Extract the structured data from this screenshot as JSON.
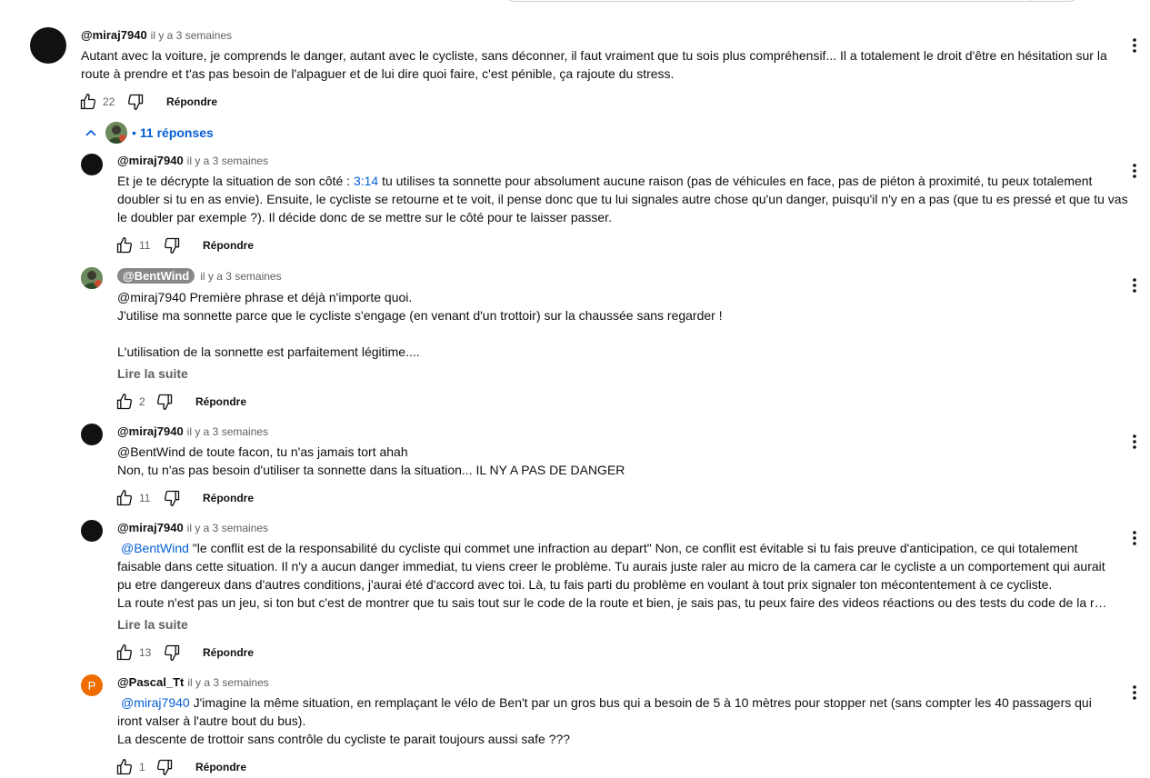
{
  "comments": [
    {
      "author": "@miraj7940",
      "time": "il y a 3 semaines",
      "lines": [
        "Autant avec la voiture, je comprends le danger, autant avec le cycliste, sans déconner, il faut vraiment que tu sois plus compréhensif... Il a totalement le droit d'être en hésitation sur la",
        "route à prendre et t'as pas besoin de l'alpaguer et de lui dire quoi faire, c'est pénible, ça rajoute du stress."
      ],
      "likes": "22",
      "reply_label": "Répondre"
    }
  ],
  "replies_toggle": {
    "label": "11 réponses",
    "dot": "•"
  },
  "replies": [
    {
      "author": "@miraj7940",
      "time": "il y a 3 semaines",
      "line1_prefix": "Et je te décrypte la situation de son côté : ",
      "timestamp_link": "3:14",
      "line1_suffix": " tu utilises ta sonnette pour absolument aucune raison (pas de véhicules en face, pas de piéton à proximité, tu peux totalement",
      "line2": "doubler si tu en as envie). Ensuite, le cycliste se retourne et te voit, il pense donc que tu lui signales autre chose qu'un danger, puisqu'il n'y en a pas (que tu es pressé et que tu vas",
      "line3": "le doubler par exemple ?). Il décide donc de se mettre sur le côté pour te laisser passer.",
      "likes": "11",
      "reply_label": "Répondre"
    },
    {
      "author": "@BentWind",
      "time": "il y a 3 semaines",
      "line1": "@miraj7940 Première phrase et déjà n'importe quoi.",
      "line2": "J'utilise ma sonnette parce que le cycliste s'engage (en venant d'un trottoir) sur la chaussée sans regarder !",
      "line4": "L'utilisation de la sonnette est parfaitement légitime....",
      "read_more": "Lire la suite",
      "likes": "2",
      "reply_label": "Répondre"
    },
    {
      "author": "@miraj7940",
      "time": "il y a 3 semaines",
      "line1": "@BentWind  de toute facon, tu n'as jamais tort ahah",
      "line2": "Non, tu n'as pas besoin d'utiliser ta sonnette dans la situation... IL NY A PAS DE DANGER",
      "likes": "11",
      "reply_label": "Répondre"
    },
    {
      "author": "@miraj7940",
      "time": "il y a 3 semaines",
      "mention": "@BentWind",
      "line1_rest": "  \"le conflit est de la responsabilité du cycliste qui commet une infraction au depart\" Non, ce conflit est évitable si tu fais preuve d'anticipation, ce qui totalement",
      "line2": "faisable dans cette situation. Il n'y a aucun danger immediat, tu viens creer le problème. Tu aurais juste raler au micro de la camera car le cycliste a un comportement qui aurait",
      "line3": "pu etre dangereux dans d'autres conditions, j'aurai été d'accord avec toi. Là, tu fais parti du problème en voulant à tout prix signaler ton mécontentement à ce cycliste.",
      "line4": "La route n'est pas un jeu, si ton but c'est de montrer que tu sais tout sur le code de la route et bien, je sais pas, tu peux faire des videos réactions ou des tests du code de la route",
      "read_more": "Lire la suite",
      "likes": "13",
      "reply_label": "Répondre"
    },
    {
      "author": "@Pascal_Tt",
      "time": "il y a 3 semaines",
      "avatar_letter": "P",
      "mention": "@miraj7940",
      "line1_rest": "  J'imagine la même situation, en remplaçant le vélo de Ben't par un gros bus qui a besoin de 5 à 10 mètres pour stopper net (sans compter les 40 passagers qui",
      "line2": "iront valser à l'autre bout du bus).",
      "line3": " La descente de trottoir sans contrôle du cycliste te parait toujours aussi safe ???",
      "likes": "1",
      "reply_label": "Répondre"
    }
  ],
  "colors": {
    "link": "#065fd4",
    "meta": "#606060",
    "text": "#0f0f0f",
    "avatar_orange": "#ef6c00",
    "author_chip": "#888888"
  },
  "icons": [
    "thumb-up-icon",
    "thumb-down-icon",
    "more-vert-icon",
    "chevron-up-icon"
  ]
}
